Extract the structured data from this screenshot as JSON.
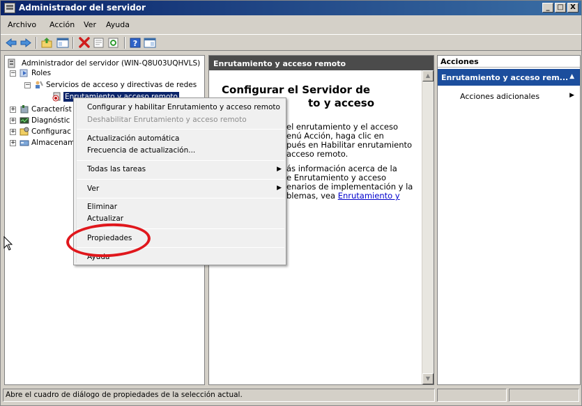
{
  "window": {
    "title": "Administrador del servidor",
    "controls": [
      "_",
      "□",
      "X"
    ]
  },
  "menubar": {
    "items": [
      "Archivo",
      "Acción",
      "Ver",
      "Ayuda"
    ]
  },
  "toolbar": {
    "buttons": [
      "back-arrow-icon",
      "forward-arrow-icon",
      "up-folder-icon",
      "show-tree-icon",
      "delete-icon",
      "properties-icon",
      "refresh-icon",
      "help-icon",
      "console-view-icon"
    ]
  },
  "tree": {
    "root": "Administrador del servidor (WIN-Q8U03UQHVLS)",
    "roles": "Roles",
    "network_policy": "Servicios de acceso y directivas de redes",
    "routing": "Enrutamiento y acceso remoto",
    "features": "Característ",
    "diagnostics": "Diagnóstic",
    "configuration": "Configurac",
    "storage": "Almacenam"
  },
  "center": {
    "header": "Enrutamiento y acceso remoto",
    "title_line1": "Configurar el Servidor de",
    "title_line2": "to y acceso",
    "para1": [
      "el enrutamiento y el acceso",
      "enú Acción, haga clic en",
      "pués en Habilitar enrutamiento",
      "acceso remoto."
    ],
    "para2": [
      "ás información acerca de la",
      "e Enrutamiento y acceso",
      "enarios de implementación y la",
      "blemas, vea"
    ],
    "link": "Enrutamiento y"
  },
  "actions": {
    "header": "Acciones",
    "group": "Enrutamiento y acceso rem...",
    "group_arrow": "▲",
    "more": "Acciones adicionales",
    "more_arrow": "▶"
  },
  "context_menu": {
    "configure": "Configurar y habilitar Enrutamiento y acceso remoto",
    "disable": "Deshabilitar Enrutamiento y acceso remoto",
    "auto_update": "Actualización automática",
    "update_freq": "Frecuencia de actualización...",
    "all_tasks": "Todas las tareas",
    "view": "Ver",
    "delete": "Eliminar",
    "refresh": "Actualizar",
    "properties": "Propiedades",
    "help": "Ayuda",
    "submenu_arrow": "▶"
  },
  "statusbar": {
    "text": "Abre el cuadro de diálogo de propiedades de la selección actual."
  },
  "colors": {
    "title_gradient_start": "#0a246a",
    "title_gradient_end": "#3a6ea5",
    "actions_group_bg": "#1c4e9d",
    "center_header_bg": "#4b4b4b",
    "highlight_oval": "#e0171c"
  }
}
